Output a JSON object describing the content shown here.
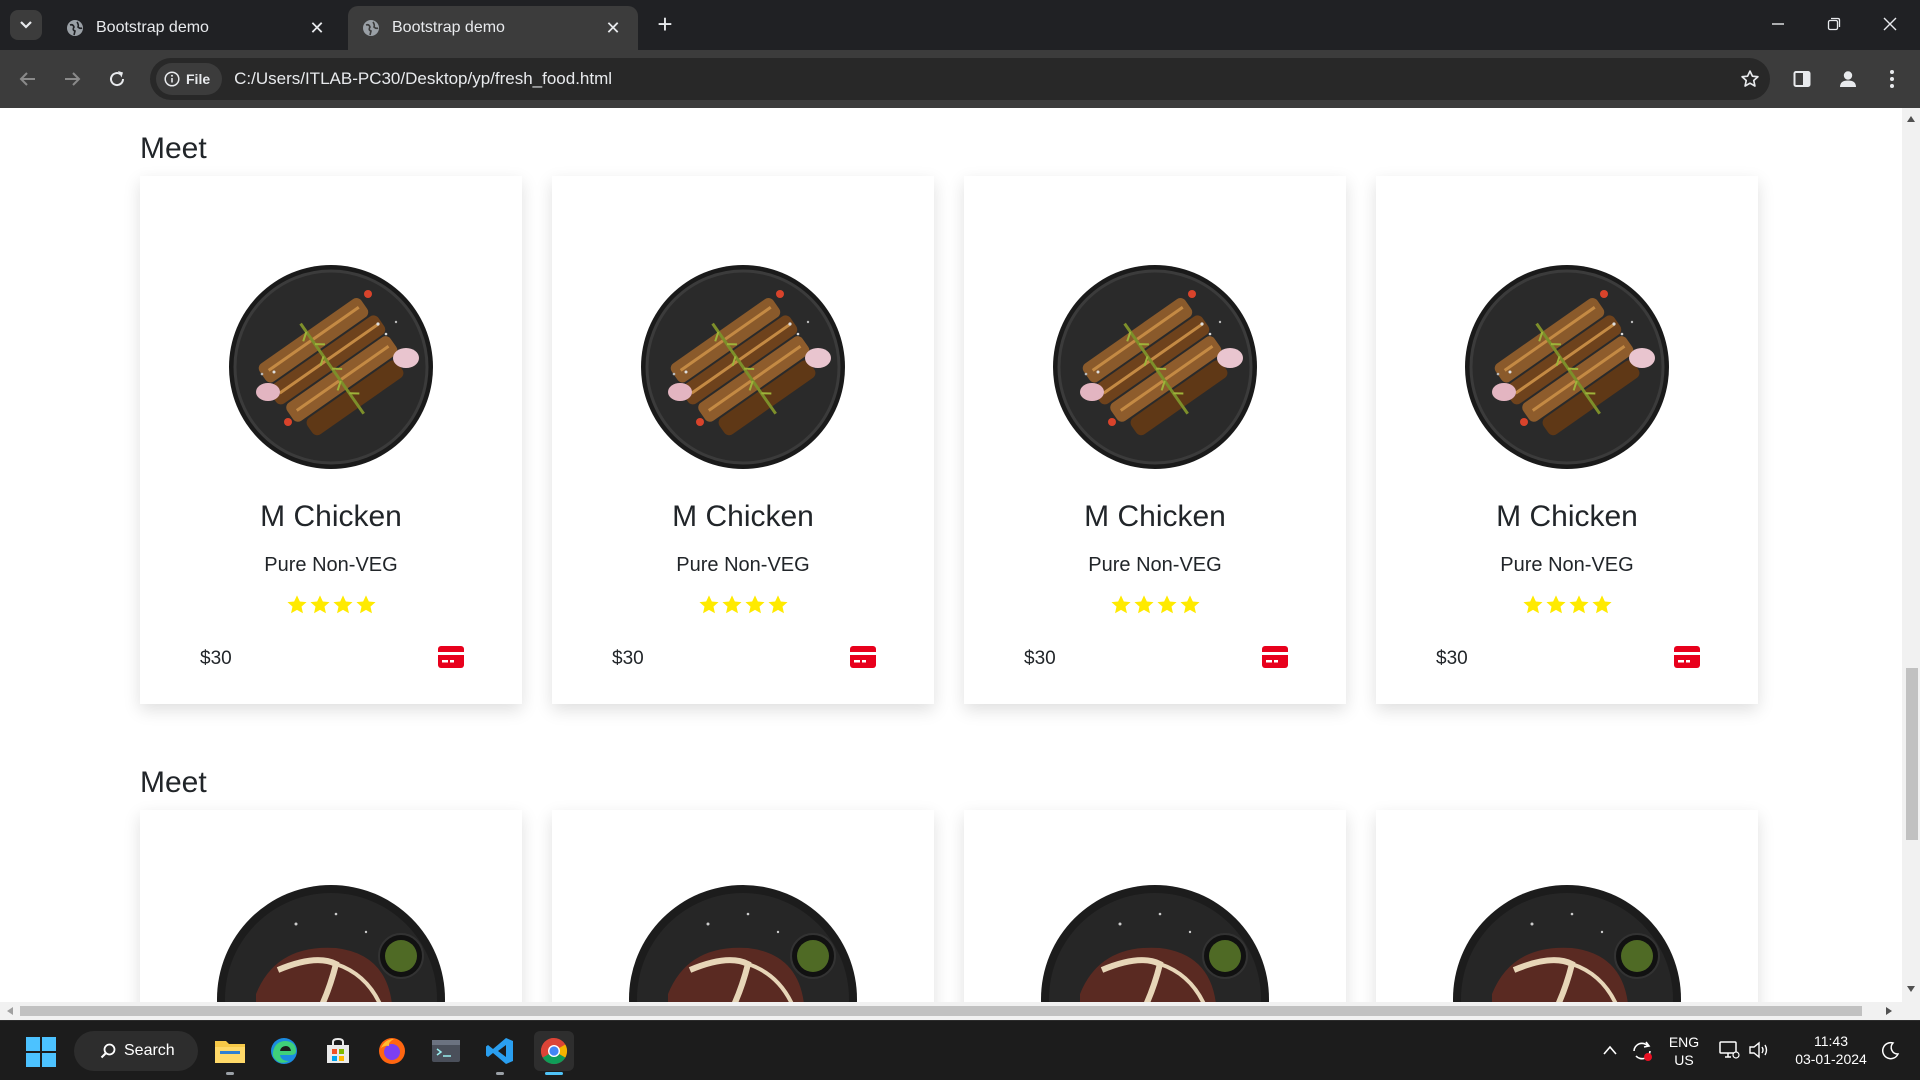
{
  "browser": {
    "tabs": [
      {
        "title": "Bootstrap demo",
        "active": false
      },
      {
        "title": "Bootstrap demo",
        "active": true
      }
    ],
    "new_tab_symbol": "+",
    "address": {
      "scheme_chip": "File",
      "url": "C:/Users/ITLAB-PC30/Desktop/yp/fresh_food.html"
    }
  },
  "page": {
    "sections": [
      {
        "title": "Meet",
        "cards": [
          {
            "name": "M Chicken",
            "description": "Pure Non-VEG",
            "rating": 4,
            "price": "$30"
          },
          {
            "name": "M Chicken",
            "description": "Pure Non-VEG",
            "rating": 4,
            "price": "$30"
          },
          {
            "name": "M Chicken",
            "description": "Pure Non-VEG",
            "rating": 4,
            "price": "$30"
          },
          {
            "name": "M Chicken",
            "description": "Pure Non-VEG",
            "rating": 4,
            "price": "$30"
          }
        ]
      },
      {
        "title": "Meet",
        "cards": [
          {},
          {},
          {},
          {}
        ]
      }
    ],
    "colors": {
      "star": "#ffea00",
      "cart": "#e8001c",
      "text": "#212529"
    }
  },
  "taskbar": {
    "search_label": "Search",
    "language": {
      "line1": "ENG",
      "line2": "US"
    },
    "clock": {
      "time": "11:43",
      "date": "03-01-2024"
    },
    "apps": [
      "file-explorer",
      "edge",
      "microsoft-store",
      "firefox",
      "terminal",
      "vscode",
      "chrome"
    ]
  }
}
